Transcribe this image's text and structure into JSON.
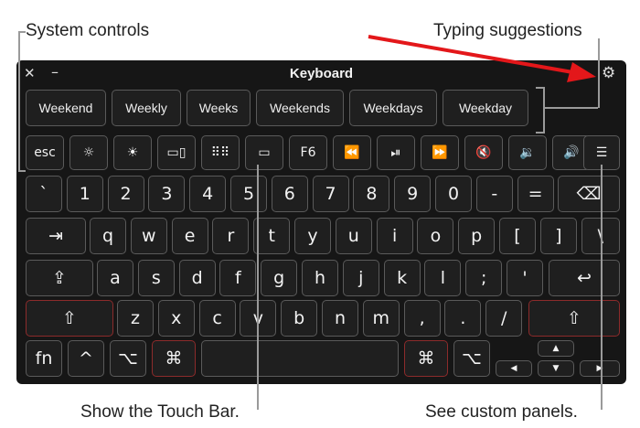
{
  "callouts": {
    "system_controls": "System controls",
    "typing_suggestions": "Typing suggestions",
    "show_touch_bar": "Show the Touch Bar.",
    "see_custom_panels": "See custom panels."
  },
  "window": {
    "title": "Keyboard",
    "close_glyph": "✕",
    "minimize_glyph": "–",
    "settings_glyph": "⚙"
  },
  "suggestions": [
    "Weekend",
    "Weekly",
    "Weeks",
    "Weekends",
    "Weekdays",
    "Weekday"
  ],
  "touchbar": {
    "esc": "esc",
    "brightness_down": "☼",
    "brightness_up": "☀",
    "mission_control": "▭▯",
    "launchpad": "⠿⠿",
    "touch_bar": "▭",
    "f6": "F6",
    "rewind": "⏪",
    "play_pause": "⏯",
    "fast_forward": "⏩",
    "mute": "🔇",
    "volume_down": "🔉",
    "volume_up": "🔊",
    "custom_panels": "☰"
  },
  "keys": {
    "row1": [
      "`",
      "1",
      "2",
      "3",
      "4",
      "5",
      "6",
      "7",
      "8",
      "9",
      "0",
      "-",
      "=",
      "⌫"
    ],
    "row2": [
      "⇥",
      "q",
      "w",
      "e",
      "r",
      "t",
      "y",
      "u",
      "i",
      "o",
      "p",
      "[",
      "]",
      "\\"
    ],
    "row3": [
      "⇪",
      "a",
      "s",
      "d",
      "f",
      "g",
      "h",
      "j",
      "k",
      "l",
      ";",
      "'",
      "↩"
    ],
    "row4": [
      "⇧",
      "z",
      "x",
      "c",
      "v",
      "b",
      "n",
      "m",
      ",",
      ".",
      "/",
      "⇧"
    ],
    "row5": {
      "fn": "fn",
      "control": "^",
      "option_left": "⌥",
      "command_left": "⌘",
      "space": "",
      "command_right": "⌘",
      "option_right": "⌥",
      "arrow_up": "▲",
      "arrow_left": "◀",
      "arrow_down": "▼",
      "arrow_right": "▶"
    }
  },
  "colors": {
    "keyboard_bg": "#161616",
    "key_border": "#5a5a5a",
    "modifier_border": "#8c2b2b",
    "arrow": "#e3171a"
  }
}
